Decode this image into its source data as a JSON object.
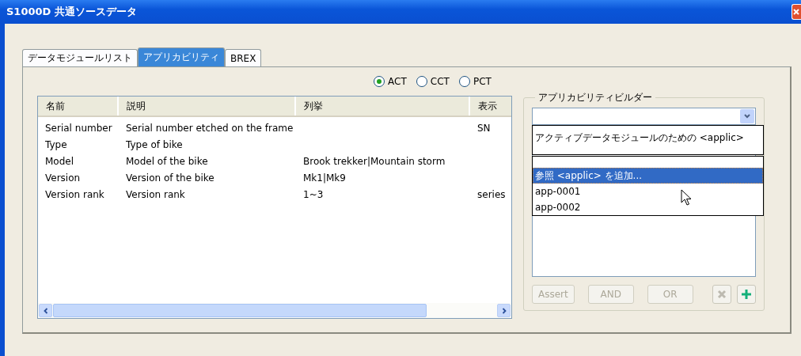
{
  "window": {
    "title": "S1000D 共通ソースデータ"
  },
  "tabs": [
    {
      "label": "データモジュールリスト",
      "selected": false
    },
    {
      "label": "アプリカビリティ",
      "selected": true
    },
    {
      "label": "BREX",
      "selected": false
    }
  ],
  "radios": [
    {
      "label": "ACT",
      "selected": true
    },
    {
      "label": "CCT",
      "selected": false
    },
    {
      "label": "PCT",
      "selected": false
    }
  ],
  "table": {
    "columns": [
      "名前",
      "説明",
      "列挙",
      "表示"
    ],
    "rows": [
      {
        "cells": [
          "Serial number",
          "Serial number etched on the frame",
          null,
          "SN"
        ]
      },
      {
        "cells": [
          "Type",
          "Type of bike",
          null,
          null
        ]
      },
      {
        "cells": [
          "Model",
          "Model of the bike",
          "Brook trekker|Mountain storm",
          null
        ]
      },
      {
        "cells": [
          "Version",
          "Version of the bike",
          "Mk1|Mk9",
          null
        ]
      },
      {
        "cells": [
          "Version rank",
          "Version rank",
          "1~3",
          "series"
        ]
      }
    ]
  },
  "builder": {
    "title": "アプリカビリティビルダー",
    "popup": {
      "heading": "アクティブデータモジュールのための <applic>",
      "items": [
        {
          "label": "参照 <applic> を追加...",
          "selected": true
        },
        {
          "label": "app-0001",
          "selected": false
        },
        {
          "label": "app-0002",
          "selected": false
        }
      ]
    },
    "buttons": [
      {
        "label": "Assert",
        "disabled": true
      },
      {
        "label": "AND",
        "disabled": true
      },
      {
        "label": "OR",
        "disabled": true
      }
    ],
    "icon_buttons": [
      {
        "kind": "delete",
        "disabled": true
      },
      {
        "kind": "add",
        "disabled": false
      }
    ]
  }
}
